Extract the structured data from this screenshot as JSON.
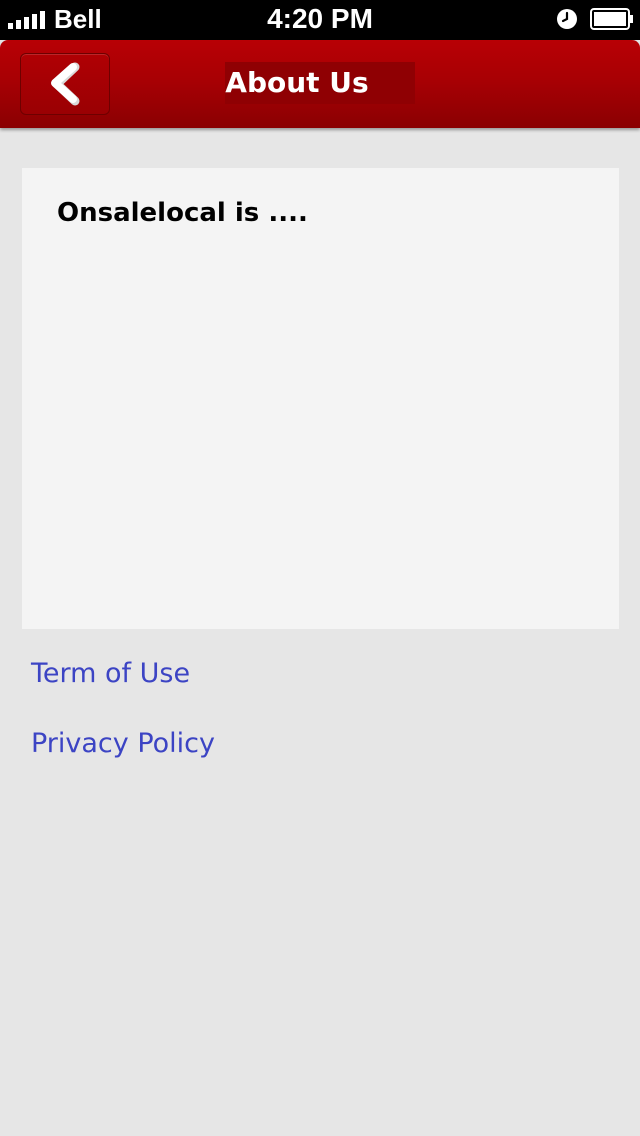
{
  "status_bar": {
    "carrier": "Bell",
    "time": "4:20 PM",
    "icons": [
      "signal-icon",
      "alarm-icon",
      "battery-icon"
    ]
  },
  "nav_bar": {
    "title": "About Us",
    "back_icon": "chevron-left-icon",
    "color": "#a80004"
  },
  "content": {
    "text": "Onsalelocal is ...."
  },
  "links": {
    "terms": "Term of Use",
    "privacy": "Privacy Policy",
    "color": "#3c44c4"
  }
}
